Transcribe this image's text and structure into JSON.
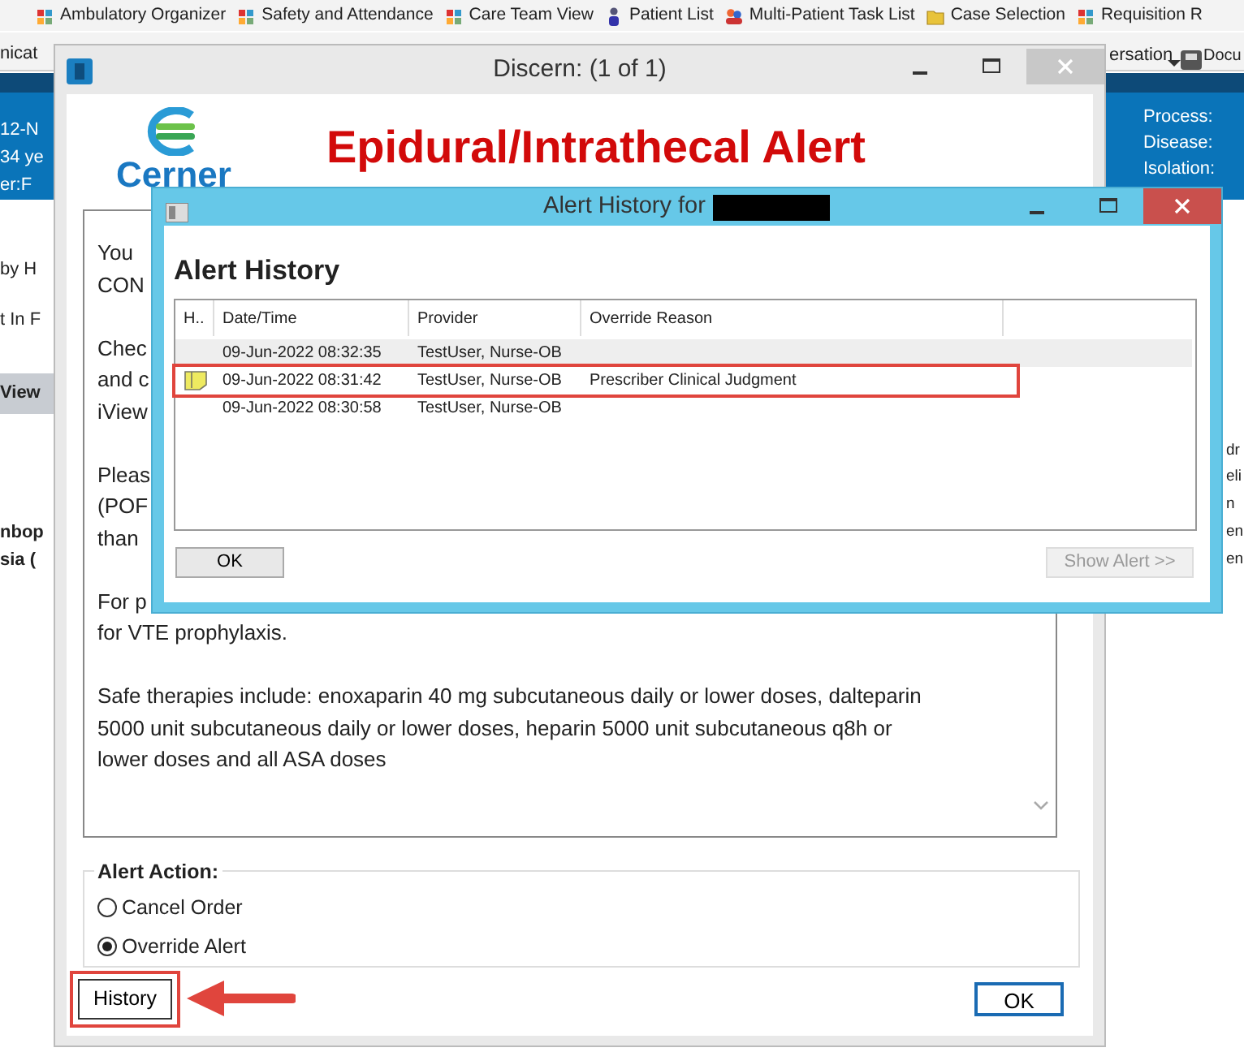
{
  "app_toolbar": {
    "shortcuts": [
      "Ambulatory Organizer",
      "Safety and Attendance",
      "Care Team View",
      "Patient List",
      "Multi-Patient Task List",
      "Case Selection",
      "Requisition R"
    ]
  },
  "app_toolbar_2": {
    "left": "nicat",
    "menu": "ersation",
    "right": "Docu"
  },
  "banner": {
    "left_fragments": [
      "12-N",
      "34 ye",
      "er:F"
    ],
    "fields": [
      "Process:",
      "Disease:",
      "Isolation:"
    ]
  },
  "left_fragments": [
    "by H",
    "t In F",
    "View",
    "nbop",
    "sia ("
  ],
  "right_fragments": [
    "dr",
    "eli",
    "n",
    "en",
    "en"
  ],
  "discern": {
    "title": "Discern:  (1 of 1)",
    "logo": "Cerner",
    "heading": "Epidural/Intrathecal Alert",
    "message": [
      [
        "You",
        "CON"
      ],
      [
        "Chec",
        "and c",
        "iView"
      ],
      [
        "Pleas",
        "(POF",
        "than"
      ],
      [
        "For p",
        "for VTE prophylaxis."
      ],
      [
        "Safe therapies include: enoxaparin 40 mg subcutaneous daily or lower doses, dalteparin",
        "5000 unit subcutaneous daily or lower doses, heparin 5000 unit subcutaneous q8h or",
        "lower doses and all ASA doses"
      ]
    ],
    "action_label": "Alert Action:",
    "actions": [
      {
        "label": "Cancel Order",
        "selected": false
      },
      {
        "label": "Override Alert",
        "selected": true
      }
    ],
    "history_button": {
      "label": "History",
      "highlighted": true
    },
    "ok_button": "OK"
  },
  "history_window": {
    "title": "Alert History for",
    "heading": "Alert History",
    "columns": [
      "H..",
      "Date/Time",
      "Provider",
      "Override Reason"
    ],
    "rows": [
      {
        "date_time": "09-Jun-2022 08:32:35",
        "provider": "TestUser, Nurse-OB",
        "has_note": false,
        "selected": true,
        "highlighted": false
      },
      {
        "date_time": "09-Jun-2022 08:31:42",
        "provider": "TestUser, Nurse-OB",
        "override_reason": "Prescriber Clinical Judgment",
        "has_note": true,
        "selected": false,
        "highlighted": true
      },
      {
        "date_time": "09-Jun-2022 08:30:58",
        "provider": "TestUser, Nurse-OB",
        "has_note": false,
        "selected": false,
        "highlighted": false
      }
    ],
    "ok_button": "OK",
    "show_alert_button": {
      "label": "Show Alert >>",
      "disabled": true
    }
  }
}
